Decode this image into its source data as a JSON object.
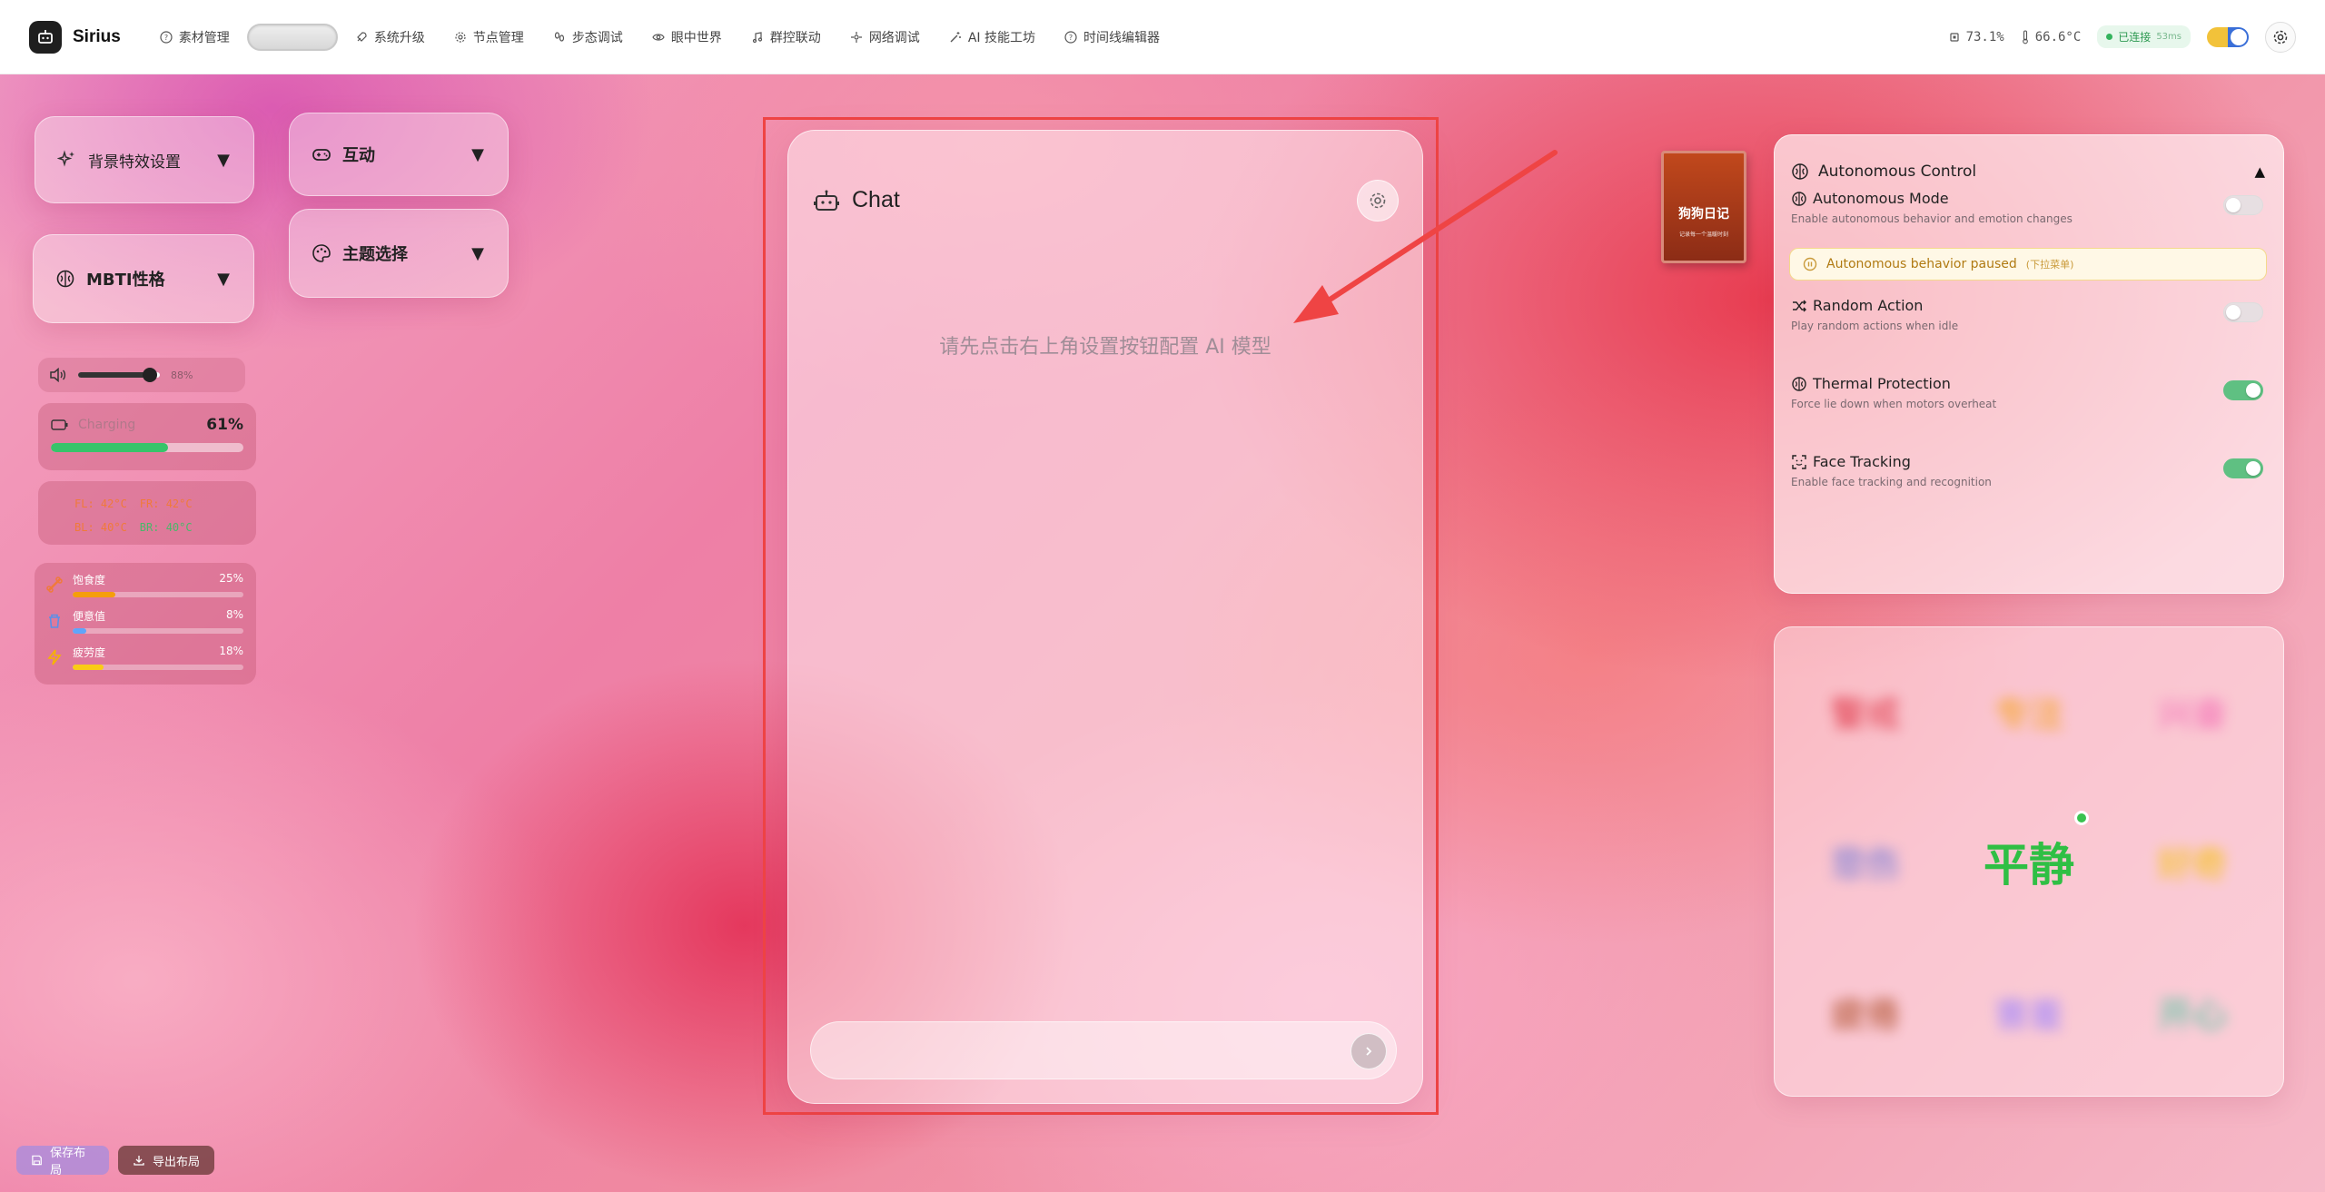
{
  "app": {
    "name": "Sirius"
  },
  "nav": [
    {
      "label": "素材管理",
      "icon": "help-circle-icon"
    },
    {
      "label": "",
      "icon": ""
    },
    {
      "label": "系统升级",
      "icon": "rocket-icon"
    },
    {
      "label": "节点管理",
      "icon": "gear-icon"
    },
    {
      "label": "步态调试",
      "icon": "footprints-icon"
    },
    {
      "label": "眼中世界",
      "icon": "eye-icon"
    },
    {
      "label": "群控联动",
      "icon": "music-note-icon"
    },
    {
      "label": "网络调试",
      "icon": "network-icon"
    },
    {
      "label": "AI 技能工坊",
      "icon": "magic-wand-icon"
    },
    {
      "label": "时间线编辑器",
      "icon": "help-circle-icon"
    }
  ],
  "status": {
    "cpu": "73.1%",
    "temp": "66.6°C",
    "connection": "已连接",
    "latency": "53ms"
  },
  "left_cards": {
    "background_effects": "背景特效设置",
    "interaction": "互动",
    "mbti": "MBTI性格",
    "theme": "主题选择"
  },
  "volume": {
    "value": "88%",
    "level": 0.88
  },
  "battery": {
    "label": "Charging",
    "percent": "61%",
    "level": 0.61
  },
  "temps": {
    "fl": "FL: 42°C",
    "fr": "FR: 42°C",
    "bl": "BL: 40°C",
    "br": "BR: 40°C"
  },
  "needs": [
    {
      "label": "饱食度",
      "value": "25%",
      "level": 0.25,
      "color": "#f59e0b"
    },
    {
      "label": "便意值",
      "value": "8%",
      "level": 0.08,
      "color": "#60a5fa"
    },
    {
      "label": "疲劳度",
      "value": "18%",
      "level": 0.18,
      "color": "#facc15"
    }
  ],
  "chat": {
    "title": "Chat",
    "hint": "请先点击右上角设置按钮配置 AI 模型",
    "input_placeholder": ""
  },
  "diary": {
    "title": "狗狗日记",
    "subtitle": "记录每一个温暖时刻"
  },
  "autonomous": {
    "title": "Autonomous Control",
    "mode": {
      "title": "Autonomous Mode",
      "desc": "Enable autonomous behavior and emotion changes",
      "on": false
    },
    "paused": {
      "text": "Autonomous behavior paused",
      "note": "(下拉菜单)"
    },
    "random": {
      "title": "Random Action",
      "desc": "Play random actions when idle",
      "on": false
    },
    "thermal": {
      "title": "Thermal Protection",
      "desc": "Force lie down when motors overheat",
      "on": true
    },
    "face": {
      "title": "Face Tracking",
      "desc": "Enable face tracking and recognition",
      "on": true
    }
  },
  "emotions": [
    {
      "label": "警戒",
      "color": "#e34a5a"
    },
    {
      "label": "专注",
      "color": "#f5a623"
    },
    {
      "label": "兴奋",
      "color": "#f472b6"
    },
    {
      "label": "悲伤",
      "color": "#7a7fd8"
    },
    {
      "label": "平静",
      "color": "#2fbf44",
      "active": true
    },
    {
      "label": "好奇",
      "color": "#f5c518"
    },
    {
      "label": "疲倦",
      "color": "#b55a3a"
    },
    {
      "label": "害羞",
      "color": "#a78bfa"
    },
    {
      "label": "开心",
      "color": "#4fc3a1"
    }
  ],
  "bottom": {
    "save": "保存布局",
    "export": "导出布局"
  },
  "colors": {
    "accent_red": "#ef4444",
    "green": "#37c46a"
  }
}
